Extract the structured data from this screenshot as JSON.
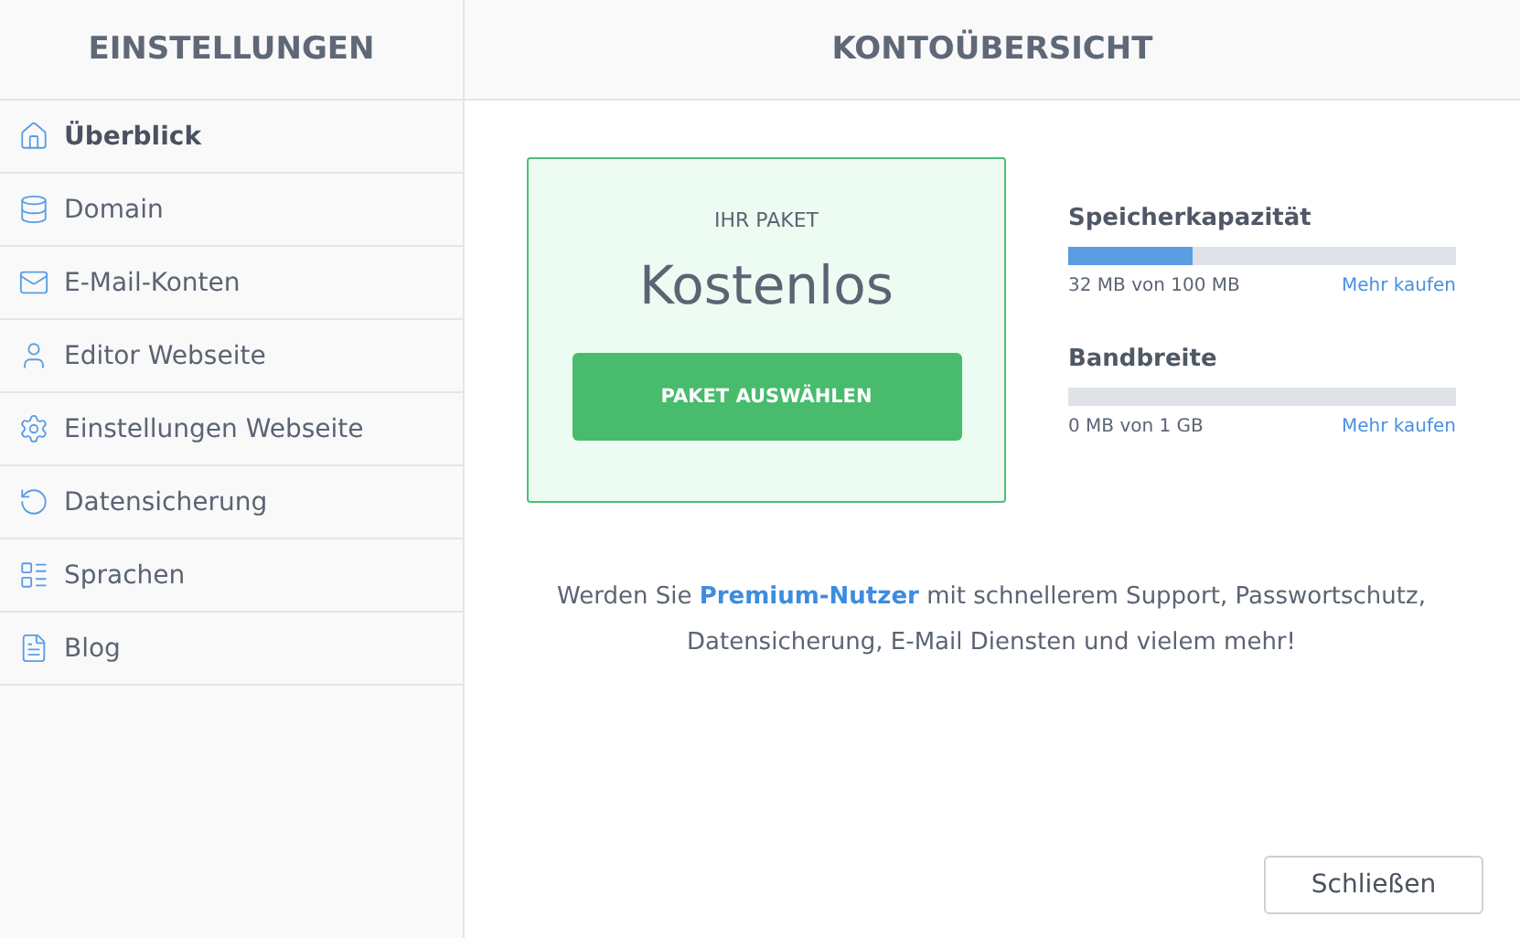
{
  "sidebar": {
    "title": "EINSTELLUNGEN",
    "items": [
      {
        "kind": "home",
        "label": "Überblick",
        "selected": true
      },
      {
        "kind": "database",
        "label": "Domain",
        "selected": false
      },
      {
        "kind": "mail",
        "label": "E-Mail-Konten",
        "selected": false
      },
      {
        "kind": "user",
        "label": "Editor Webseite",
        "selected": false
      },
      {
        "kind": "gear",
        "label": "Einstellungen Webseite",
        "selected": false
      },
      {
        "kind": "backup",
        "label": "Datensicherung",
        "selected": false
      },
      {
        "kind": "table",
        "label": "Sprachen",
        "selected": false
      },
      {
        "kind": "file",
        "label": "Blog",
        "selected": false
      }
    ]
  },
  "main": {
    "title": "KONTOÜBERSICHT",
    "package": {
      "caption": "IHR PAKET",
      "name": "Kostenlos",
      "button": "PAKET AUSWÄHLEN"
    },
    "meters": [
      {
        "name": "Speicherkapazität",
        "level": 0.32,
        "reading": "32 MB von 100 MB",
        "link": "Mehr kaufen"
      },
      {
        "name": "Bandbreite",
        "reading": "0 MB von 1 GB",
        "link": "Mehr kaufen"
      }
    ],
    "promo": {
      "before": "Werden Sie ",
      "link": "Premium-Nutzer",
      "after": " mit schnellerem Support, Passwortschutz, Datensicherung, E-Mail Diensten und vielem mehr!"
    },
    "close_button": "Schließen"
  }
}
